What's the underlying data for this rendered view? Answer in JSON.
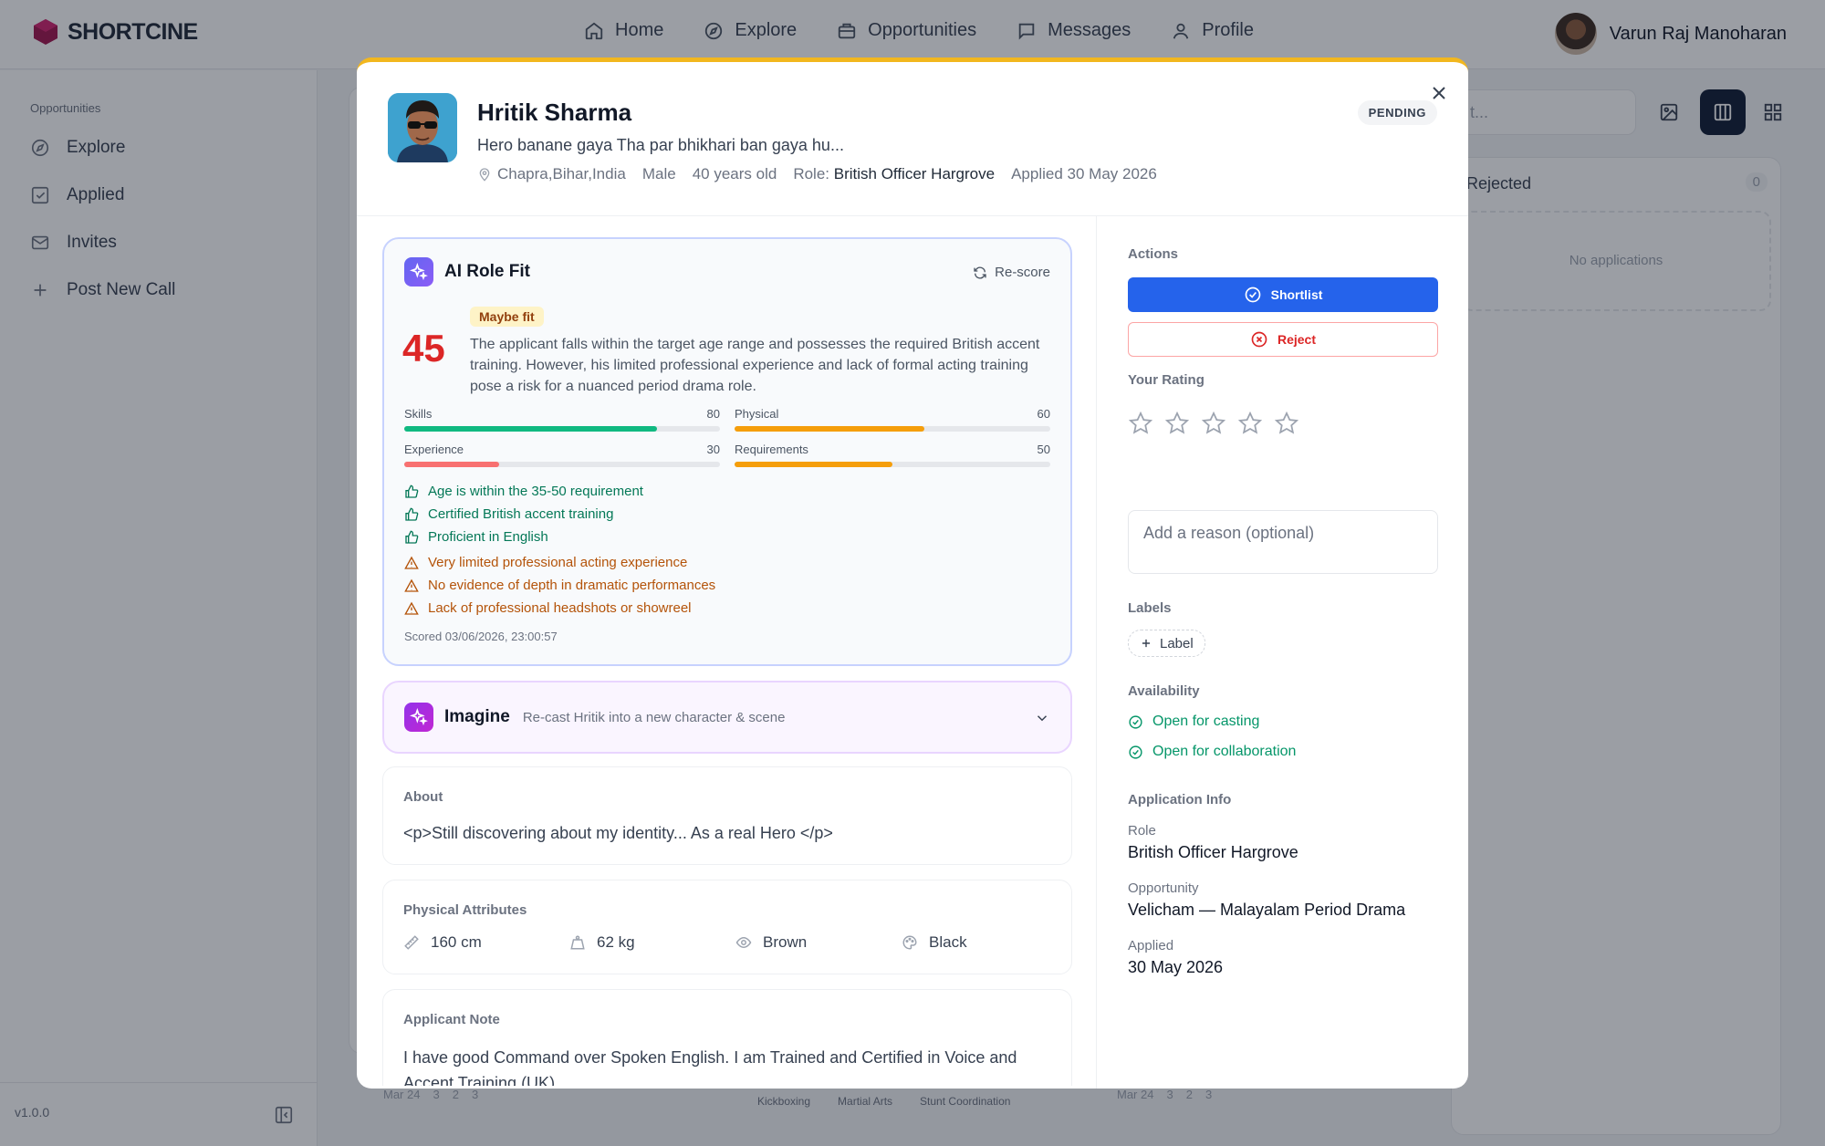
{
  "app": {
    "brand": "SHORTCINE",
    "nav": [
      {
        "label": "Home",
        "icon": "home-icon"
      },
      {
        "label": "Explore",
        "icon": "compass-icon"
      },
      {
        "label": "Opportunities",
        "icon": "briefcase-icon"
      },
      {
        "label": "Messages",
        "icon": "message-icon"
      },
      {
        "label": "Profile",
        "icon": "user-icon"
      }
    ],
    "user_name": "Varun Raj Manoharan"
  },
  "sidebar": {
    "section": "Opportunities",
    "items": [
      {
        "label": "Explore",
        "icon": "compass-icon"
      },
      {
        "label": "Applied",
        "icon": "checkbox-icon"
      },
      {
        "label": "Invites",
        "icon": "mail-icon"
      },
      {
        "label": "Post New Call",
        "icon": "plus-icon"
      }
    ],
    "version": "v1.0.0"
  },
  "background": {
    "search_fragment": "t...",
    "rejected_title": "Rejected",
    "rejected_count": "0",
    "rejected_empty": "No applications",
    "card_meta": [
      {
        "date": "Mar 24",
        "a": "3",
        "b": "2",
        "c": "3"
      },
      {
        "date": "Mar 24",
        "a": "3",
        "b": "2",
        "c": "3"
      }
    ],
    "skill_chips": [
      "Kickboxing",
      "Martial Arts",
      "Stunt Coordination"
    ]
  },
  "applicant": {
    "name": "Hritik Sharma",
    "tagline": "Hero banane gaya Tha par bhikhari ban gaya hu...",
    "location": "Chapra,Bihar,India",
    "gender": "Male",
    "age": "40 years old",
    "role_prefix": "Role:",
    "role": "British Officer Hargrove",
    "applied": "Applied 30 May 2026",
    "status": "PENDING"
  },
  "fit": {
    "title": "AI Role Fit",
    "rescore": "Re-score",
    "score": "45",
    "verdict": "Maybe fit",
    "summary": "The applicant falls within the target age range and possesses the required British accent training. However, his limited professional experience and lack of formal acting training pose a risk for a nuanced period drama role.",
    "bars": [
      {
        "label": "Skills",
        "value": "80",
        "fraction": 0.8,
        "color": "#10b981"
      },
      {
        "label": "Physical",
        "value": "60",
        "fraction": 0.6,
        "color": "#f59e0b"
      },
      {
        "label": "Experience",
        "value": "30",
        "fraction": 0.3,
        "color": "#f87171"
      },
      {
        "label": "Requirements",
        "value": "50",
        "fraction": 0.5,
        "color": "#f59e0b"
      }
    ],
    "pros": [
      "Age is within the 35-50 requirement",
      "Certified British accent training",
      "Proficient in English"
    ],
    "cons": [
      "Very limited professional acting experience",
      "No evidence of depth in dramatic performances",
      "Lack of professional headshots or showreel"
    ],
    "scored": "Scored 03/06/2026, 23:00:57"
  },
  "imagine": {
    "title": "Imagine",
    "subtitle": "Re-cast Hritik into a new character & scene"
  },
  "about": {
    "title": "About",
    "body": "<p>Still discovering about my identity... As a real Hero </p>"
  },
  "physical": {
    "title": "Physical Attributes",
    "height": "160 cm",
    "weight": "62 kg",
    "eyes": "Brown",
    "hair": "Black"
  },
  "note": {
    "title": "Applicant Note",
    "body": "I have good Command over Spoken English. I am Trained and Certified in Voice and Accent Training (UK)"
  },
  "actions": {
    "title": "Actions",
    "shortlist": "Shortlist",
    "reject": "Reject",
    "rating_title": "Your Rating",
    "rating": 0,
    "rating_max": 5,
    "reason_placeholder": "Add a reason (optional)",
    "labels_title": "Labels",
    "add_label": "Label",
    "availability_title": "Availability",
    "availability": [
      "Open for casting",
      "Open for collaboration"
    ],
    "info_title": "Application Info",
    "info": [
      {
        "key": "Role",
        "value": "British Officer Hargrove"
      },
      {
        "key": "Opportunity",
        "value": "Velicham — Malayalam Period Drama"
      },
      {
        "key": "Applied",
        "value": "30 May 2026"
      }
    ]
  },
  "colors": {
    "primary": "#2563eb",
    "danger": "#dc2626",
    "success": "#059669",
    "pending_border": "#f2b71e",
    "nav_dark": "#111c34"
  }
}
